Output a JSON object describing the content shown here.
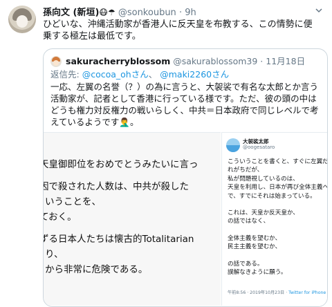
{
  "tweet": {
    "display_name": "孫向文 (新垣)",
    "name_emojis": "😷☂",
    "handle": "@sonkoubun",
    "separator": "·",
    "time": "9h",
    "text": "ひどいな、沖縄活動家が香港人に反天皇を布教する、この情勢に便乗する極左は最低です。"
  },
  "quoted": {
    "display_name": "sakuracherryblossom",
    "handle": "@sakurablossom39",
    "separator": "·",
    "date": "11月18日",
    "reply_prefix": "返信先:",
    "reply_mentions": [
      "@cocoa_ohさん",
      "@maki2260さん"
    ],
    "reply_joiner": "、",
    "text": "一応、左翼の名誉（？）の為に言うと、大袈裟で有名な太郎とか言う活動家が、記者として香港に行っている様です。ただ、彼の頭の中はどうも権力対反権力の戦いらしく、中共＝日本政府で同じレベルで考えているようです🤦‍♂️。"
  },
  "image_left": {
    "lines": [
      "天皇御即位をおめでとうみたいに言っ",
      "因で殺された人数は、中共が殺した",
      "いうことを、",
      "ておく。",
      "ずる日本人たちは懐古的Totalitarian",
      "り、",
      "から非常に危険である。"
    ]
  },
  "image_right": {
    "name": "大袈裟太郎",
    "handle": "@oogesataro",
    "lines": [
      "こういうことを書くと、すぐに左翼だ、などと",
      "れがちだが、",
      "私が問題視しているのは、",
      "天皇を利用し、日本が再び全体主義へと向か",
      "で、すでにそれは始まっている。",
      "",
      "これは、天皇か反天皇か、",
      "の話ではなく、",
      "",
      "全体主義を望むか、",
      "民主主義を望むか、",
      "",
      "の話である。",
      "誤解なきように願う。"
    ],
    "timestamp": "午前8:56 · 2019年10月23日 ·",
    "via": "Twitter for iPhone"
  }
}
